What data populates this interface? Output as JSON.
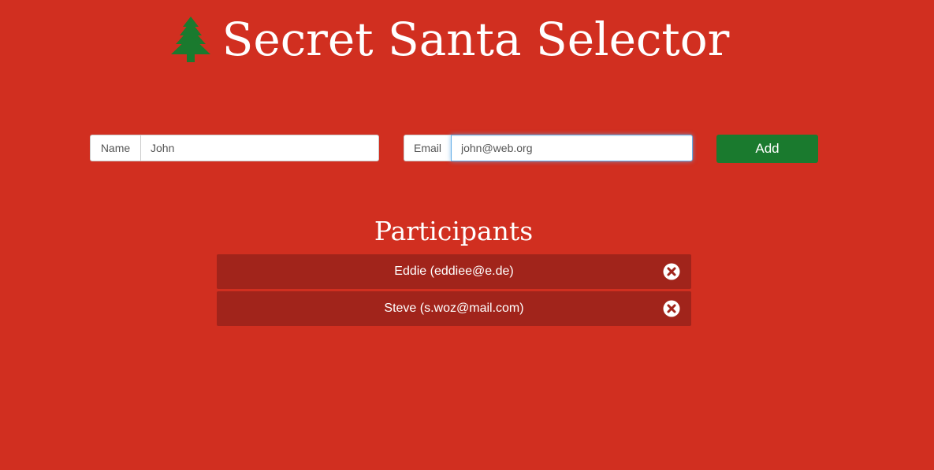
{
  "app": {
    "title": "Secret Santa Selector",
    "icon": "tree-icon"
  },
  "colors": {
    "background": "#d12f20",
    "row_background": "#a1241b",
    "tree": "#1a7a2e",
    "add_button": "#1a7a2e",
    "text": "#ffffff"
  },
  "form": {
    "name": {
      "label": "Name",
      "value": "John"
    },
    "email": {
      "label": "Email",
      "value": "john@web.org"
    },
    "add_label": "Add"
  },
  "participants": {
    "title": "Participants",
    "items": [
      {
        "label": "Eddie (eddiee@e.de)",
        "action_icon": "remove-icon"
      },
      {
        "label": "Steve (s.woz@mail.com)",
        "action_icon": "remove-icon"
      }
    ]
  }
}
